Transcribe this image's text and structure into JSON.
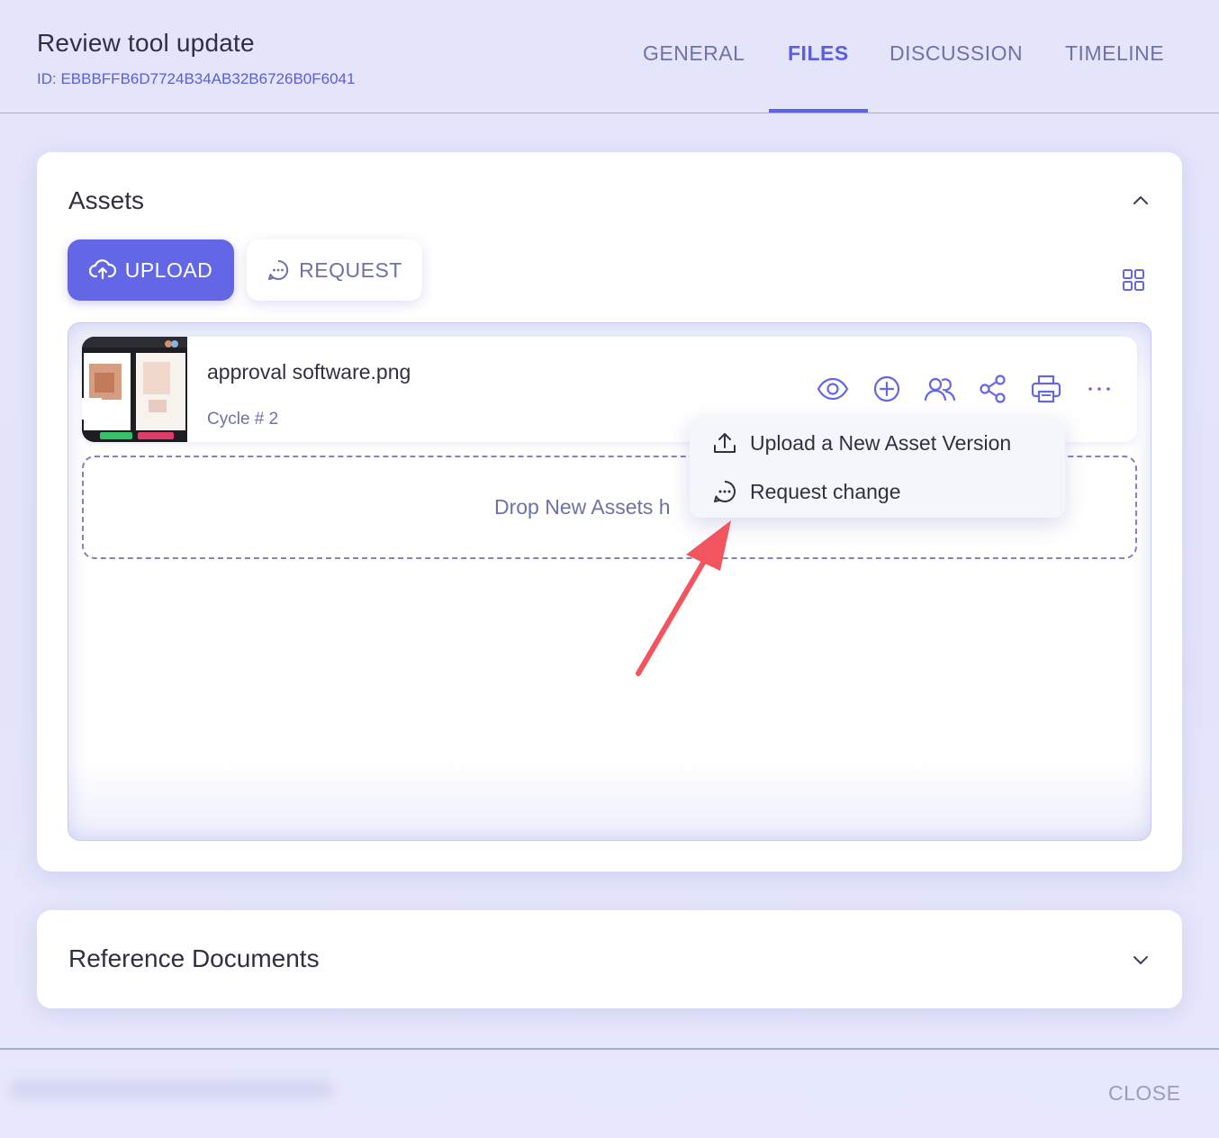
{
  "header": {
    "title": "Review tool update",
    "id_text": "ID: EBBBFFB6D7724B34AB32B6726B0F6041",
    "tabs": [
      {
        "label": "GENERAL",
        "active": false
      },
      {
        "label": "FILES",
        "active": true
      },
      {
        "label": "DISCUSSION",
        "active": false
      },
      {
        "label": "TIMELINE",
        "active": false
      }
    ]
  },
  "assets": {
    "title": "Assets",
    "upload_label": "UPLOAD",
    "request_label": "REQUEST",
    "items": [
      {
        "name": "approval software.png",
        "cycle": "Cycle # 2",
        "icons": [
          "eye-icon",
          "plus-circle-icon",
          "users-icon",
          "share-icon",
          "print-icon",
          "more-icon"
        ]
      }
    ],
    "dropzone_text": "Drop New Assets h",
    "menu": [
      {
        "label": "Upload a New Asset Version",
        "icon": "upload-icon"
      },
      {
        "label": "Request change",
        "icon": "chat-icon"
      }
    ]
  },
  "reference": {
    "title": "Reference Documents"
  },
  "footer": {
    "close_label": "CLOSE"
  },
  "colors": {
    "accent": "#6367e6",
    "annotation_arrow": "#f25560",
    "background": "#e4e5fb"
  }
}
